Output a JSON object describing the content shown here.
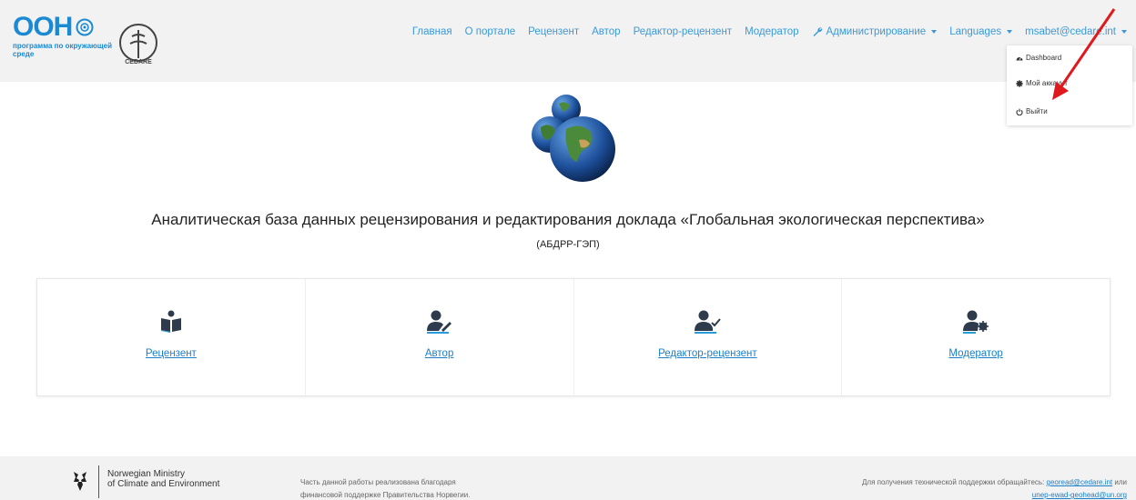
{
  "header": {
    "logo_text": "ООН",
    "logo_subtitle": "программа по окружающей среде",
    "cedare_label": "CEDARE",
    "nav": [
      {
        "label": "Главная"
      },
      {
        "label": "О портале"
      },
      {
        "label": "Рецензент"
      },
      {
        "label": "Автор"
      },
      {
        "label": "Редактор-рецензент"
      },
      {
        "label": "Модератор"
      },
      {
        "label": "Администрирование"
      },
      {
        "label": "Languages"
      },
      {
        "label": "msabet@cedare.int"
      }
    ]
  },
  "user_menu": {
    "items": [
      {
        "label": "Dashboard",
        "icon": "dashboard-icon"
      },
      {
        "label": "Мой аккаунт",
        "icon": "gear-icon"
      },
      {
        "label": "Выйти",
        "icon": "power-icon"
      }
    ]
  },
  "main": {
    "title": "Аналитическая база данных рецензирования и редактирования доклада «Глобальная экологическая перспектива»",
    "subtitle": "(АБДРР-ГЭП)",
    "roles": [
      {
        "label": "Рецензент",
        "icon": "reader-icon"
      },
      {
        "label": "Автор",
        "icon": "user-edit-icon"
      },
      {
        "label": "Редактор-рецензент",
        "icon": "user-check-icon"
      },
      {
        "label": "Модератор",
        "icon": "user-gear-icon"
      }
    ]
  },
  "footer": {
    "ministry_line1": "Norwegian Ministry",
    "ministry_line2": "of Climate and Environment",
    "funding_line1": "Часть данной работы реализована благодаря",
    "funding_line2": "финансовой поддержке Правительства Норвегии.",
    "support_text": "Для получения технической поддержки обращайтесь:",
    "support_email1": "georead@cedare.int",
    "support_or": "или",
    "support_email2": "unep-ewad-geohead@un.org"
  },
  "colors": {
    "accent": "#1a8ad4",
    "link": "#1a7fc8",
    "arrow": "#e0191e"
  }
}
